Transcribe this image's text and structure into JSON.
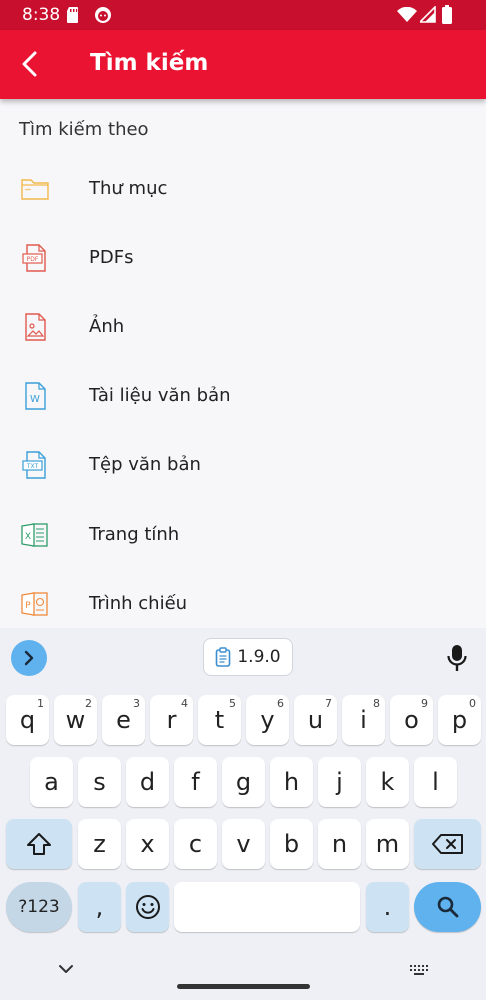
{
  "status_bar": {
    "time": "8:38"
  },
  "app_bar": {
    "title": "Tìm kiếm"
  },
  "search_by": {
    "label": "Tìm kiếm theo",
    "items": [
      {
        "label": "Thư mục",
        "icon": "folder-icon"
      },
      {
        "label": "PDFs",
        "icon": "pdf-file-icon"
      },
      {
        "label": "Ảnh",
        "icon": "image-file-icon"
      },
      {
        "label": "Tài liệu văn bản",
        "icon": "word-file-icon"
      },
      {
        "label": "Tệp văn bản",
        "icon": "txt-file-icon"
      },
      {
        "label": "Trang tính",
        "icon": "excel-file-icon"
      },
      {
        "label": "Trình chiếu",
        "icon": "powerpoint-file-icon"
      }
    ]
  },
  "keyboard": {
    "clipboard_chip": "1.9.0",
    "row1": [
      {
        "k": "q",
        "h": "1"
      },
      {
        "k": "w",
        "h": "2"
      },
      {
        "k": "e",
        "h": "3"
      },
      {
        "k": "r",
        "h": "4"
      },
      {
        "k": "t",
        "h": "5"
      },
      {
        "k": "y",
        "h": "6"
      },
      {
        "k": "u",
        "h": "7"
      },
      {
        "k": "i",
        "h": "8"
      },
      {
        "k": "o",
        "h": "9"
      },
      {
        "k": "p",
        "h": "0"
      }
    ],
    "row2": [
      "a",
      "s",
      "d",
      "f",
      "g",
      "h",
      "j",
      "k",
      "l"
    ],
    "row3": [
      "z",
      "x",
      "c",
      "v",
      "b",
      "n",
      "m"
    ],
    "symbols_key": "?123",
    "comma_key": ",",
    "period_key": "."
  },
  "colors": {
    "app_bar": "#ea1332",
    "status_bar": "#c8102e",
    "keyboard_accent": "#5fb2ee"
  }
}
